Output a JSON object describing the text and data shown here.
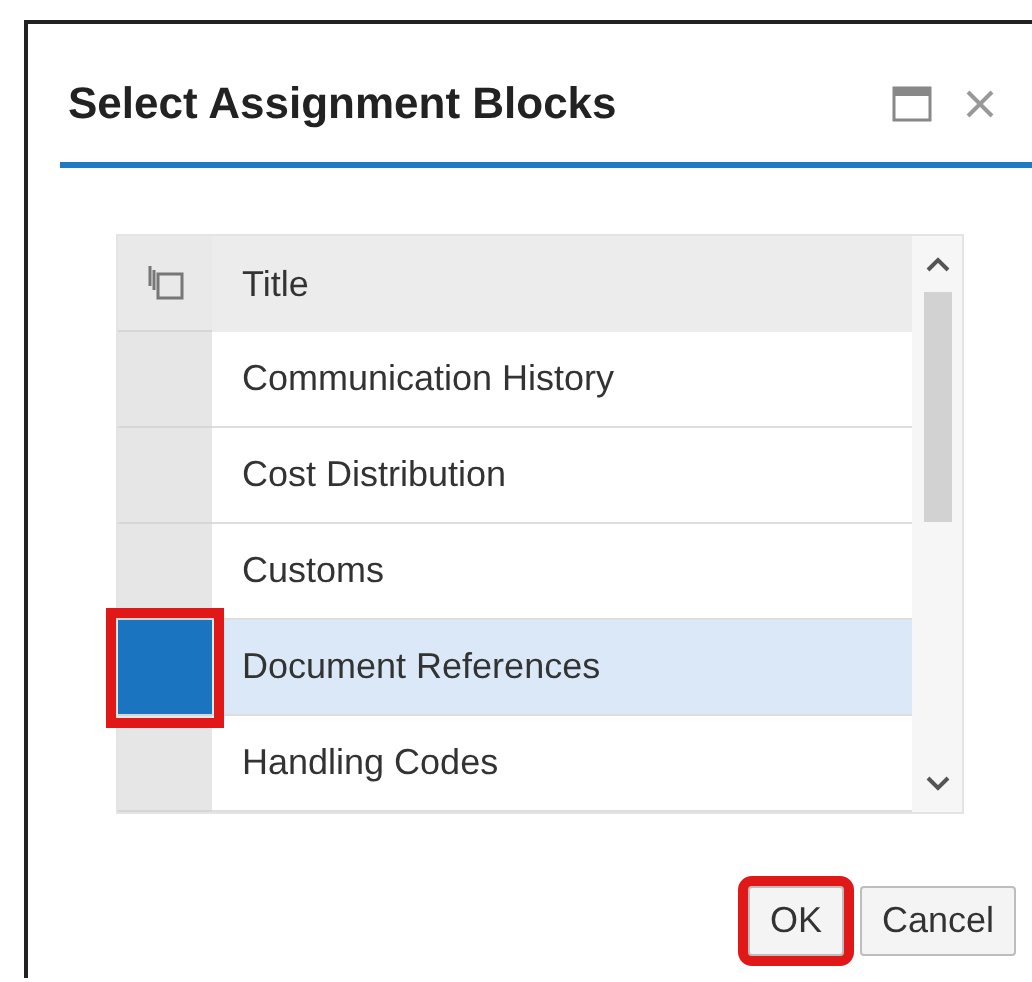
{
  "dialog": {
    "title": "Select Assignment Blocks"
  },
  "table": {
    "columns": [
      {
        "title": "Title"
      }
    ],
    "rows": [
      {
        "title": "Communication History",
        "selected": false,
        "highlighted": false
      },
      {
        "title": "Cost Distribution",
        "selected": false,
        "highlighted": false
      },
      {
        "title": "Customs",
        "selected": false,
        "highlighted": false
      },
      {
        "title": "Document References",
        "selected": true,
        "highlighted": true
      },
      {
        "title": "Handling Codes",
        "selected": false,
        "highlighted": false
      }
    ]
  },
  "buttons": [
    {
      "label": "OK",
      "highlighted": true
    },
    {
      "label": "Cancel",
      "highlighted": false
    }
  ]
}
